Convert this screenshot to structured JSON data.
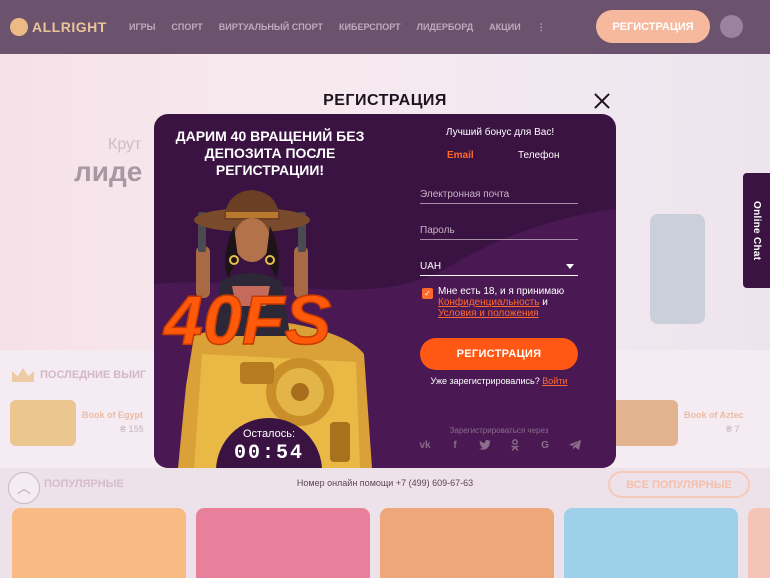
{
  "site": {
    "logo_text": "ALLRIGHT",
    "nav": [
      "ИГРЫ",
      "СПОРТ",
      "ВИРТУАЛЬНЫЙ СПОРТ",
      "КИБЕРСПОРТ",
      "ЛИДЕРБОРД",
      "АКЦИИ",
      "⋮"
    ],
    "register_button": "РЕГИСТРАЦИЯ",
    "hero_line1": "Крут",
    "hero_line2": "лиде",
    "last_wins_title": "ПОСЛЕДНИЕ ВЫИГ",
    "last_wins": [
      {
        "name": "Book of Egypt",
        "amount": "₴ 155"
      },
      {
        "name": "Book of Aztec",
        "amount": "₴ 7"
      }
    ],
    "popular_title": "ПОПУЛЯРНЫЕ",
    "all_popular_button": "ВСЕ ПОПУЛЯРНЫЕ",
    "help_text": "Номер онлайн помощи +7 (499) 609-67-63"
  },
  "chat_tab": "Online Chat",
  "modal": {
    "title": "РЕГИСТРАЦИЯ",
    "promo_title": "ДАРИМ 40 ВРАЩЕНИЙ БЕЗ ДЕПОЗИТА ПОСЛЕ РЕГИСТРАЦИИ!",
    "art_text": "40FS",
    "timer_label": "Осталось:",
    "timer_value": "00:54",
    "best_bonus": "Лучший бонус для Вас!",
    "tabs": [
      {
        "label": "Email",
        "active": true
      },
      {
        "label": "Телефон",
        "active": false
      }
    ],
    "email_placeholder": "Электронная почта",
    "password_placeholder": "Пароль",
    "currency": "UAH",
    "agree_prefix": "Мне есть 18, и я принимаю",
    "privacy_link": "Конфиденциальность",
    "agree_and": "и",
    "terms_link": "Условия и положения",
    "submit_label": "РЕГИСТРАЦИЯ",
    "already_text": "Уже зарегистрировались?",
    "login_link": "Войти",
    "via_text": "Зарегистрироваться через",
    "socials": [
      {
        "icon": "vk-icon",
        "glyph": "vk"
      },
      {
        "icon": "facebook-icon",
        "glyph": "f"
      },
      {
        "icon": "twitter-icon",
        "glyph": "t"
      },
      {
        "icon": "odnoklassniki-icon",
        "glyph": "ok"
      },
      {
        "icon": "google-icon",
        "glyph": "G"
      },
      {
        "icon": "telegram-icon",
        "glyph": "➤"
      }
    ]
  },
  "colors": {
    "modal_bg": "#3a1342",
    "accent": "#ff5714",
    "link": "#ff6a2c"
  }
}
